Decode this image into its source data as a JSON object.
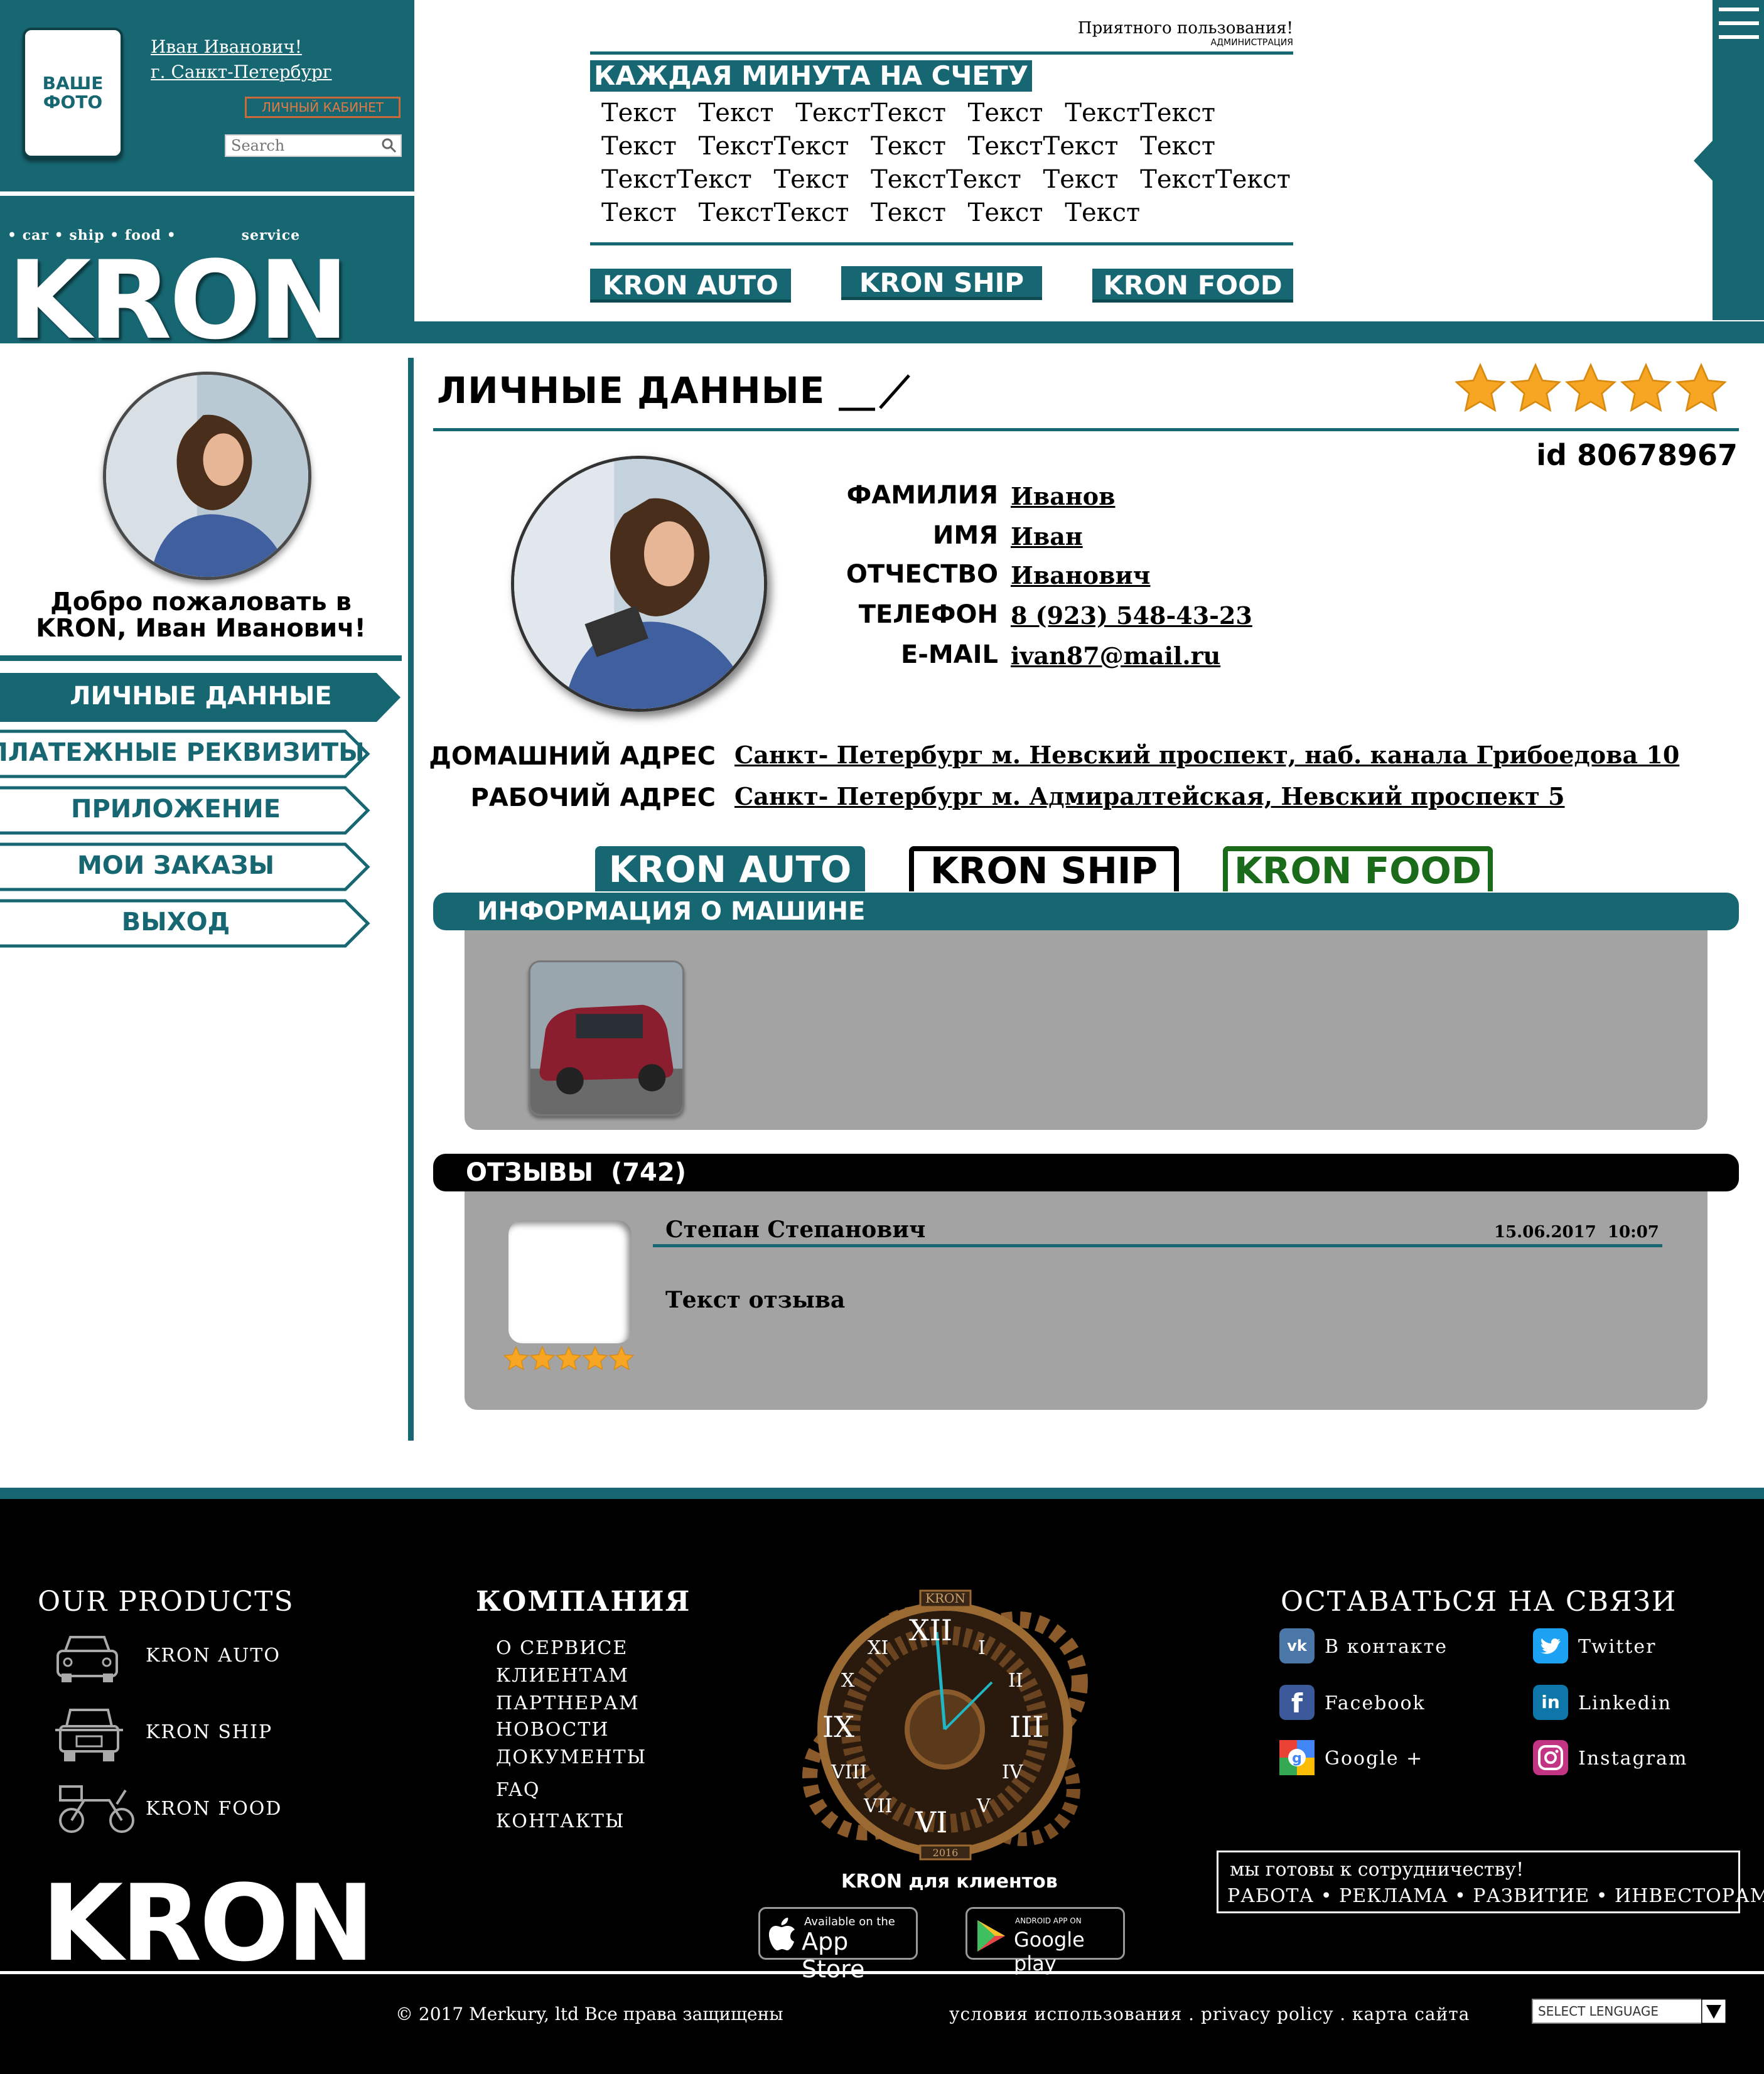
{
  "header": {
    "photo_label": "ВАШЕ ФОТО",
    "user_name": "Иван Иванович!",
    "user_city": "г. Санкт-Петербург",
    "cabinet_button": "ЛИЧНЫЙ КАБИНЕТ",
    "search_placeholder": "Search",
    "tagline": "• car • ship • food •            service",
    "logo": "KRON",
    "greeting": "Приятного пользования!",
    "greeting_sub": "АДМИНИСТРАЦИЯ",
    "news_title": "КАЖДАЯ МИНУТА НА СЧЕТУ",
    "news_text": "Текст Текст ТекстТекст Текст ТекстТекст Текст ТекстТекст Текст ТекстТекст Текст ТекстТекст Текст ТекстТекст Текст ТекстТекст Текст ТекстТекст Текст Текст Текст",
    "buttons": [
      "KRON AUTO",
      "KRON SHIP",
      "KRON FOOD"
    ]
  },
  "sidebar": {
    "welcome": "Добро пожаловать в KRON, Иван Иванович!",
    "nav": [
      "ЛИЧНЫЕ ДАННЫЕ",
      "ПЛАТЕЖНЫЕ РЕКВИЗИТЫ",
      "ПРИЛОЖЕНИЕ",
      "МОИ ЗАКАЗЫ",
      "ВЫХОД"
    ]
  },
  "profile": {
    "title": "ЛИЧНЫЕ ДАННЫЕ",
    "rating_stars": 5,
    "id_label": "id 80678967",
    "fields": [
      {
        "label": "ФАМИЛИЯ",
        "value": "Иванов"
      },
      {
        "label": "ИМЯ",
        "value": "Иван"
      },
      {
        "label": "ОТЧЕСТВО",
        "value": "Иванович"
      },
      {
        "label": "ТЕЛЕФОН",
        "value": "8 (923) 548-43-23"
      },
      {
        "label": "E-MAIL",
        "value": "ivan87@mail.ru"
      }
    ],
    "addresses": [
      {
        "label": "ДОМАШНИЙ АДРЕС",
        "value": "Санкт- Петербург м. Невский проспект, наб. канала Грибоедова 10"
      },
      {
        "label": "РАБОЧИЙ АДРЕС",
        "value": "Санкт- Петербург м. Адмиралтейская, Невский проспект 5"
      }
    ],
    "tabs": [
      "KRON AUTO",
      "KRON SHIP",
      "KRON FOOD"
    ],
    "info_title": "ИНФОРМАЦИЯ О МАШИНЕ",
    "reviews_title": "ОТЗЫВЫ  (742)",
    "review": {
      "author": "Степан Степанович",
      "date": "15.06.2017  10:07",
      "text": "Текст отзыва",
      "stars": 5
    }
  },
  "footer": {
    "products_title": "OUR PRODUCTS",
    "products": [
      "KRON AUTO",
      "KRON SHIP",
      "KRON FOOD"
    ],
    "company_title": "КОМПАНИЯ",
    "company_links": [
      "О СЕРВИСЕ",
      "КЛИЕНТАМ",
      "ПАРТНЕРАМ",
      "НОВОСТИ",
      "ДОКУМЕНТЫ",
      "FAQ",
      "КОНТАКТЫ"
    ],
    "clock_brand": "KRON",
    "clock_year": "2016",
    "clock_numerals": [
      "XII",
      "I",
      "II",
      "III",
      "IV",
      "V",
      "VI",
      "VII",
      "VIII",
      "IX",
      "X",
      "XI"
    ],
    "app_label": "KRON для клиентов",
    "appstore_small": "Available on the",
    "appstore_big": "App Store",
    "gplay_small": "ANDROID APP ON",
    "gplay_big": "Google play",
    "social_title": "ОСТАВАТЬСЯ НА СВЯЗИ",
    "social": [
      "В контакте",
      "Twitter",
      "Facebook",
      "Linkedin",
      "Google +",
      "Instagram"
    ],
    "coop_title": "мы готовы к сотрудничеству!",
    "coop_links": "РАБОТА • РЕКЛАМА • РАЗВИТИЕ • ИНВЕСТОРАМ",
    "logo": "KRON",
    "copyright": "© 2017 Merkury, ltd Все права защищены",
    "legal": "условия использования . privacy policy . карта сайта",
    "language": "SELECT LENGUAGE"
  },
  "colors": {
    "accent": "#176773",
    "panel": "#a3a3a3",
    "food_green": "#1a6b1a",
    "star": "#f6a623"
  }
}
